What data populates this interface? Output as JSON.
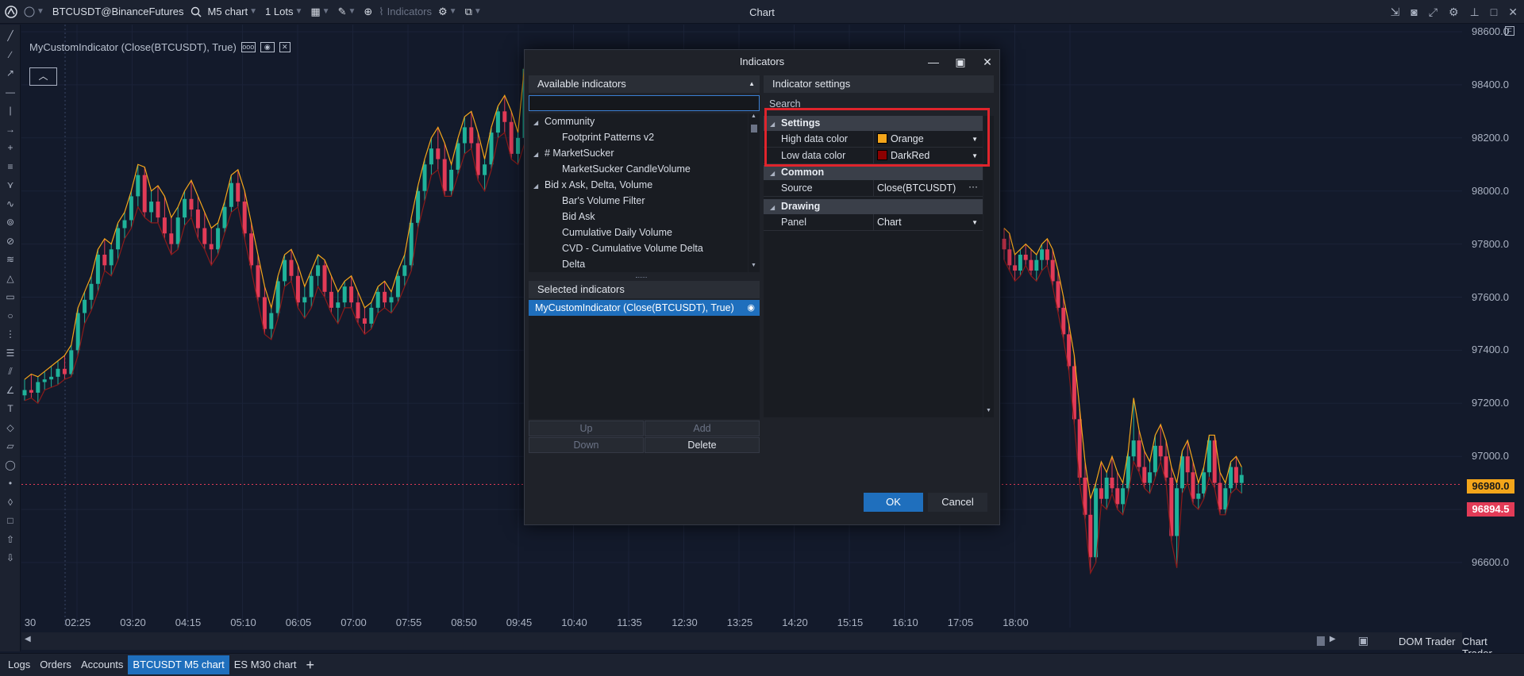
{
  "topbar": {
    "symbol": "BTCUSDT@BinanceFutures",
    "timeframe": "M5 chart",
    "lots": "1 Lots",
    "indicators_label": "Indicators",
    "window_title": "Chart"
  },
  "chart": {
    "indicator_label": "MyCustomIndicator (Close(BTCUSDT), True)",
    "y_ticks": [
      "98600.0",
      "98400.0",
      "98200.0",
      "98000.0",
      "97800.0",
      "97600.0",
      "97400.0",
      "97200.0",
      "97000.0",
      "96800.0",
      "96600.0"
    ],
    "x_ticks": [
      "30",
      "02:25",
      "03:20",
      "04:15",
      "05:10",
      "06:05",
      "07:00",
      "07:55",
      "08:50",
      "09:45",
      "10:40",
      "11:35",
      "12:30",
      "13:25",
      "14:20",
      "15:15",
      "16:10",
      "17:05",
      "18:00"
    ],
    "price_high_badge": "96980.0",
    "price_current_badge": "96894.5",
    "colors": {
      "up": "#1fb29a",
      "down": "#e23b57",
      "high_line": "#f3a51a",
      "low_line": "#8b1a1a"
    },
    "candles": [
      [
        97230,
        97290,
        97210,
        97250
      ],
      [
        97250,
        97310,
        97220,
        97240
      ],
      [
        97240,
        97300,
        97200,
        97280
      ],
      [
        97280,
        97320,
        97250,
        97290
      ],
      [
        97290,
        97340,
        97260,
        97300
      ],
      [
        97300,
        97360,
        97270,
        97330
      ],
      [
        97330,
        97380,
        97290,
        97310
      ],
      [
        97310,
        97420,
        97300,
        97400
      ],
      [
        97400,
        97560,
        97380,
        97540
      ],
      [
        97540,
        97620,
        97500,
        97590
      ],
      [
        97590,
        97680,
        97550,
        97650
      ],
      [
        97650,
        97780,
        97620,
        97760
      ],
      [
        97760,
        97820,
        97700,
        97720
      ],
      [
        97720,
        97800,
        97680,
        97780
      ],
      [
        97780,
        97880,
        97740,
        97860
      ],
      [
        97860,
        97920,
        97820,
        97890
      ],
      [
        97890,
        98000,
        97860,
        97980
      ],
      [
        97980,
        98100,
        97940,
        98060
      ],
      [
        98060,
        98090,
        97900,
        97920
      ],
      [
        97920,
        98000,
        97880,
        97960
      ],
      [
        97960,
        98020,
        97880,
        97900
      ],
      [
        97900,
        97980,
        97820,
        97840
      ],
      [
        97840,
        97900,
        97760,
        97800
      ],
      [
        97800,
        97940,
        97780,
        97900
      ],
      [
        97900,
        98000,
        97870,
        97970
      ],
      [
        97970,
        98040,
        97900,
        97930
      ],
      [
        97930,
        97980,
        97820,
        97860
      ],
      [
        97860,
        97920,
        97780,
        97800
      ],
      [
        97800,
        97860,
        97720,
        97780
      ],
      [
        97780,
        97880,
        97760,
        97860
      ],
      [
        97860,
        97960,
        97840,
        97940
      ],
      [
        97940,
        98060,
        97920,
        98030
      ],
      [
        98030,
        98080,
        97940,
        97960
      ],
      [
        97960,
        98000,
        97820,
        97840
      ],
      [
        97840,
        97880,
        97700,
        97720
      ],
      [
        97720,
        97760,
        97580,
        97600
      ],
      [
        97600,
        97640,
        97460,
        97480
      ],
      [
        97480,
        97560,
        97440,
        97540
      ],
      [
        97540,
        97680,
        97520,
        97660
      ],
      [
        97660,
        97760,
        97640,
        97740
      ],
      [
        97740,
        97780,
        97660,
        97680
      ],
      [
        97680,
        97720,
        97560,
        97580
      ],
      [
        97580,
        97640,
        97520,
        97600
      ],
      [
        97600,
        97700,
        97560,
        97680
      ],
      [
        97680,
        97760,
        97640,
        97720
      ],
      [
        97720,
        97740,
        97600,
        97620
      ],
      [
        97620,
        97680,
        97540,
        97560
      ],
      [
        97560,
        97620,
        97500,
        97580
      ],
      [
        97580,
        97660,
        97560,
        97640
      ],
      [
        97640,
        97680,
        97560,
        97580
      ],
      [
        97580,
        97620,
        97500,
        97520
      ],
      [
        97520,
        97560,
        97460,
        97500
      ],
      [
        97500,
        97580,
        97480,
        97560
      ],
      [
        97560,
        97640,
        97540,
        97620
      ],
      [
        97620,
        97660,
        97560,
        97580
      ],
      [
        97580,
        97620,
        97540,
        97600
      ],
      [
        97600,
        97700,
        97580,
        97680
      ],
      [
        97680,
        97760,
        97640,
        97720
      ],
      [
        97720,
        97900,
        97700,
        97880
      ],
      [
        97880,
        98020,
        97860,
        98000
      ],
      [
        98000,
        98120,
        97960,
        98100
      ],
      [
        98100,
        98200,
        98060,
        98160
      ],
      [
        98160,
        98240,
        98080,
        98120
      ],
      [
        98120,
        98180,
        97980,
        98000
      ],
      [
        98000,
        98100,
        97980,
        98080
      ],
      [
        98080,
        98200,
        98060,
        98180
      ],
      [
        98180,
        98280,
        98140,
        98240
      ],
      [
        98240,
        98300,
        98160,
        98180
      ],
      [
        98180,
        98220,
        98040,
        98060
      ],
      [
        98060,
        98120,
        98000,
        98100
      ],
      [
        98100,
        98240,
        98080,
        98220
      ],
      [
        98220,
        98320,
        98200,
        98300
      ],
      [
        98300,
        98360,
        98220,
        98260
      ],
      [
        98260,
        98300,
        98120,
        98140
      ],
      [
        98140,
        98220,
        98100,
        98200
      ],
      [
        98200,
        98480,
        98180,
        98460
      ],
      [
        98460,
        98520,
        98340,
        98380
      ],
      [
        98380,
        98420,
        98200,
        98240
      ]
    ],
    "right_candles": [
      [
        97820,
        97860,
        97740,
        97780
      ],
      [
        97780,
        97840,
        97700,
        97720
      ],
      [
        97720,
        97760,
        97660,
        97700
      ],
      [
        97700,
        97780,
        97680,
        97760
      ],
      [
        97760,
        97800,
        97720,
        97740
      ],
      [
        97740,
        97780,
        97680,
        97700
      ],
      [
        97700,
        97760,
        97660,
        97740
      ],
      [
        97740,
        97800,
        97700,
        97780
      ],
      [
        97780,
        97820,
        97720,
        97740
      ],
      [
        97740,
        97780,
        97640,
        97660
      ],
      [
        97660,
        97700,
        97540,
        97560
      ],
      [
        97560,
        97600,
        97440,
        97460
      ],
      [
        97460,
        97500,
        97320,
        97340
      ],
      [
        97340,
        97380,
        97120,
        97140
      ],
      [
        97140,
        97180,
        96900,
        96920
      ],
      [
        96920,
        96980,
        96760,
        96780
      ],
      [
        96780,
        96840,
        96560,
        96620
      ],
      [
        96620,
        96900,
        96600,
        96880
      ],
      [
        96880,
        96980,
        96820,
        96840
      ],
      [
        96840,
        96940,
        96800,
        96920
      ],
      [
        96920,
        97000,
        96860,
        96880
      ],
      [
        96880,
        96940,
        96800,
        96820
      ],
      [
        96820,
        96900,
        96780,
        96880
      ],
      [
        96880,
        97020,
        96860,
        97000
      ],
      [
        97000,
        97220,
        96980,
        97060
      ],
      [
        97060,
        97100,
        96940,
        96960
      ],
      [
        96960,
        97020,
        96880,
        96900
      ],
      [
        96900,
        96980,
        96860,
        96940
      ],
      [
        96940,
        97080,
        96920,
        97040
      ],
      [
        97040,
        97120,
        96980,
        97000
      ],
      [
        97000,
        97060,
        96900,
        96920
      ],
      [
        96920,
        96960,
        96680,
        96700
      ],
      [
        96700,
        96900,
        96580,
        96880
      ],
      [
        96880,
        97020,
        96860,
        97000
      ],
      [
        97000,
        97060,
        96900,
        96940
      ],
      [
        96940,
        96980,
        96820,
        96840
      ],
      [
        96840,
        96900,
        96800,
        96860
      ],
      [
        96860,
        96960,
        96840,
        96940
      ],
      [
        96940,
        97080,
        96920,
        97060
      ],
      [
        97060,
        97080,
        96880,
        96900
      ],
      [
        96900,
        96940,
        96780,
        96800
      ],
      [
        96800,
        96900,
        96780,
        96880
      ],
      [
        96880,
        96980,
        96860,
        96960
      ],
      [
        96960,
        97000,
        96880,
        96900
      ],
      [
        96900,
        96960,
        96860,
        96930
      ]
    ]
  },
  "left_tools": [
    "cursor",
    "line",
    "ray",
    "hline",
    "vline",
    "arrow",
    "cross",
    "fib",
    "pitch",
    "brush",
    "zoom",
    "ruler",
    "pattern",
    "triangle",
    "rect",
    "ellipse",
    "gann",
    "levels",
    "channel",
    "angle",
    "text",
    "tag",
    "callout",
    "circle",
    "dot",
    "diamond",
    "square",
    "up",
    "down"
  ],
  "bottom_tabs": [
    "Logs",
    "Orders",
    "Accounts",
    "BTCUSDT M5 chart",
    "ES M30 chart"
  ],
  "bottom_right": [
    "DOM Trader",
    "Chart Trader"
  ],
  "dialog": {
    "title": "Indicators",
    "available_header": "Available indicators",
    "search_value": "",
    "tree": [
      {
        "label": "Community",
        "level": 0,
        "expanded": true
      },
      {
        "label": "Footprint Patterns v2",
        "level": 1
      },
      {
        "label": "# MarketSucker",
        "level": 0,
        "expanded": true
      },
      {
        "label": "MarketSucker CandleVolume",
        "level": 1
      },
      {
        "label": "Bid x Ask, Delta, Volume",
        "level": 0,
        "expanded": true
      },
      {
        "label": "Bar's Volume Filter",
        "level": 1
      },
      {
        "label": "Bid Ask",
        "level": 1
      },
      {
        "label": "Cumulative Daily Volume",
        "level": 1
      },
      {
        "label": "CVD - Cumulative Volume Delta",
        "level": 1
      },
      {
        "label": "Delta",
        "level": 1
      }
    ],
    "selected_header": "Selected indicators",
    "selected_item": "MyCustomIndicator (Close(BTCUSDT), True)",
    "buttons": {
      "up": "Up",
      "add": "Add",
      "down": "Down",
      "delete": "Delete",
      "ok": "OK",
      "cancel": "Cancel"
    },
    "settings_header": "Indicator settings",
    "settings_search_placeholder": "Search",
    "categories": {
      "settings": {
        "label": "Settings",
        "rows": [
          {
            "name": "High data color",
            "value": "Orange",
            "swatch": "#f3a51a"
          },
          {
            "name": "Low data color",
            "value": "DarkRed",
            "swatch": "#8b0000"
          }
        ]
      },
      "common": {
        "label": "Common",
        "rows": [
          {
            "name": "Source",
            "value": "Close(BTCUSDT)"
          }
        ]
      },
      "drawing": {
        "label": "Drawing",
        "rows": [
          {
            "name": "Panel",
            "value": "Chart"
          }
        ]
      }
    }
  }
}
